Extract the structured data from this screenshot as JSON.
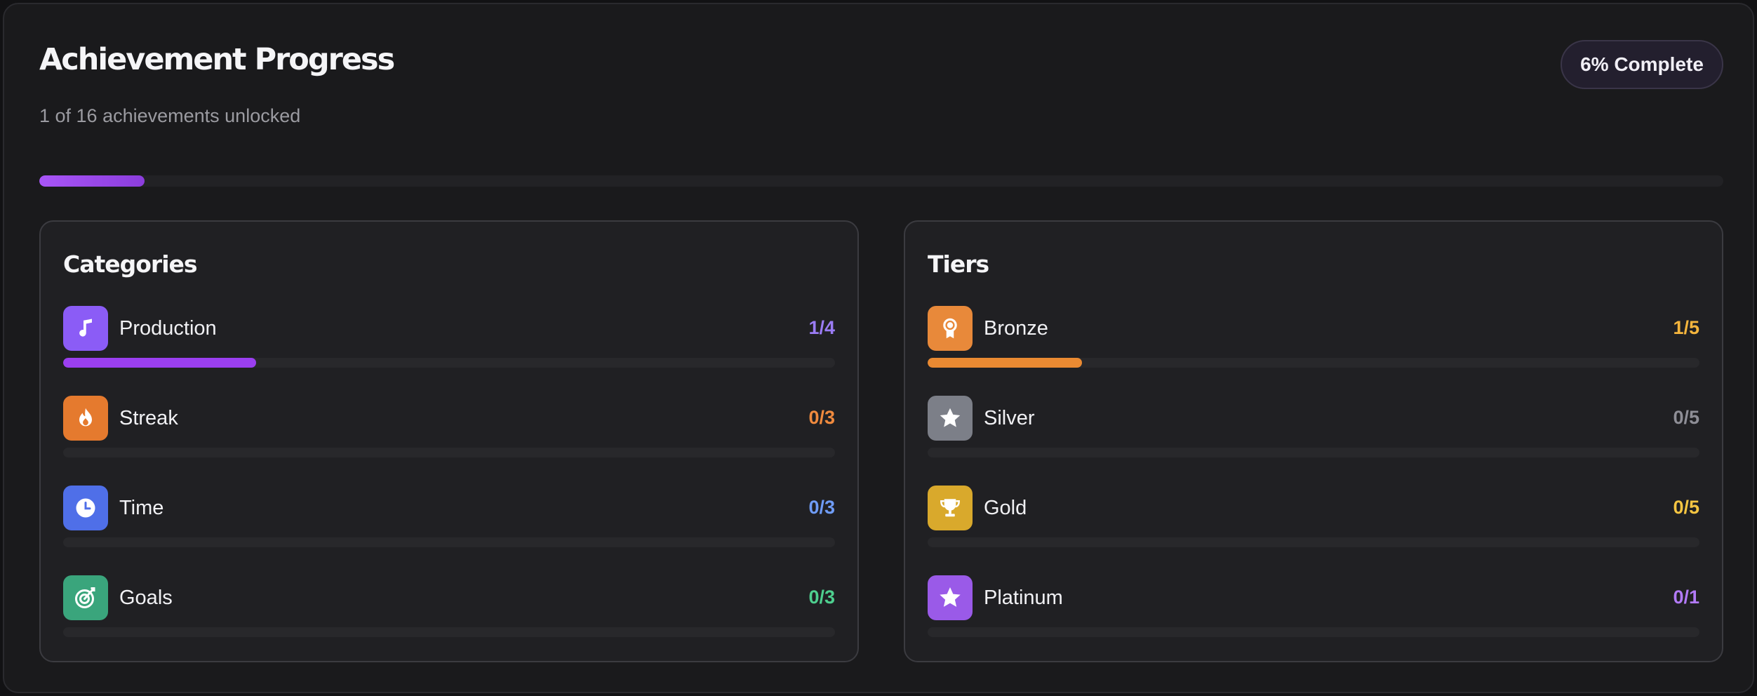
{
  "header": {
    "title": "Achievement Progress",
    "subtitle": "1 of 16 achievements unlocked",
    "badge": "6% Complete",
    "progress_fraction": 0.0625
  },
  "categories": {
    "title": "Categories",
    "items": [
      {
        "label": "Production",
        "count": "1/4",
        "unlocked": 1,
        "total": 4,
        "icon": "music-note-icon",
        "color": "#9b7cf5",
        "icon_bg": "#8b5cf6",
        "fill": "#9b3ff0"
      },
      {
        "label": "Streak",
        "count": "0/3",
        "unlocked": 0,
        "total": 3,
        "icon": "flame-icon",
        "color": "#f08a3e",
        "icon_bg": "#e57a2e",
        "fill": "#e57a2e"
      },
      {
        "label": "Time",
        "count": "0/3",
        "unlocked": 0,
        "total": 3,
        "icon": "clock-icon",
        "color": "#6f9cf7",
        "icon_bg": "#4f6fe8",
        "fill": "#4f6fe8"
      },
      {
        "label": "Goals",
        "count": "0/3",
        "unlocked": 0,
        "total": 3,
        "icon": "target-icon",
        "color": "#4ecf8f",
        "icon_bg": "#3aa57c",
        "fill": "#3aa57c"
      }
    ]
  },
  "tiers": {
    "title": "Tiers",
    "items": [
      {
        "label": "Bronze",
        "count": "1/5",
        "unlocked": 1,
        "total": 5,
        "icon": "medal-icon",
        "color": "#f5b53d",
        "icon_bg": "#e8893a",
        "fill": "#ea8a32"
      },
      {
        "label": "Silver",
        "count": "0/5",
        "unlocked": 0,
        "total": 5,
        "icon": "star-icon",
        "color": "#8e8e96",
        "icon_bg": "#7c7f88",
        "fill": "#7c7f88"
      },
      {
        "label": "Gold",
        "count": "0/5",
        "unlocked": 0,
        "total": 5,
        "icon": "trophy-icon",
        "color": "#f5c542",
        "icon_bg": "#d9a92c",
        "fill": "#d9a92c"
      },
      {
        "label": "Platinum",
        "count": "0/1",
        "unlocked": 0,
        "total": 1,
        "icon": "star-badge-icon",
        "color": "#b27af7",
        "icon_bg": "#9a5ae8",
        "fill": "#9a5ae8"
      }
    ]
  }
}
